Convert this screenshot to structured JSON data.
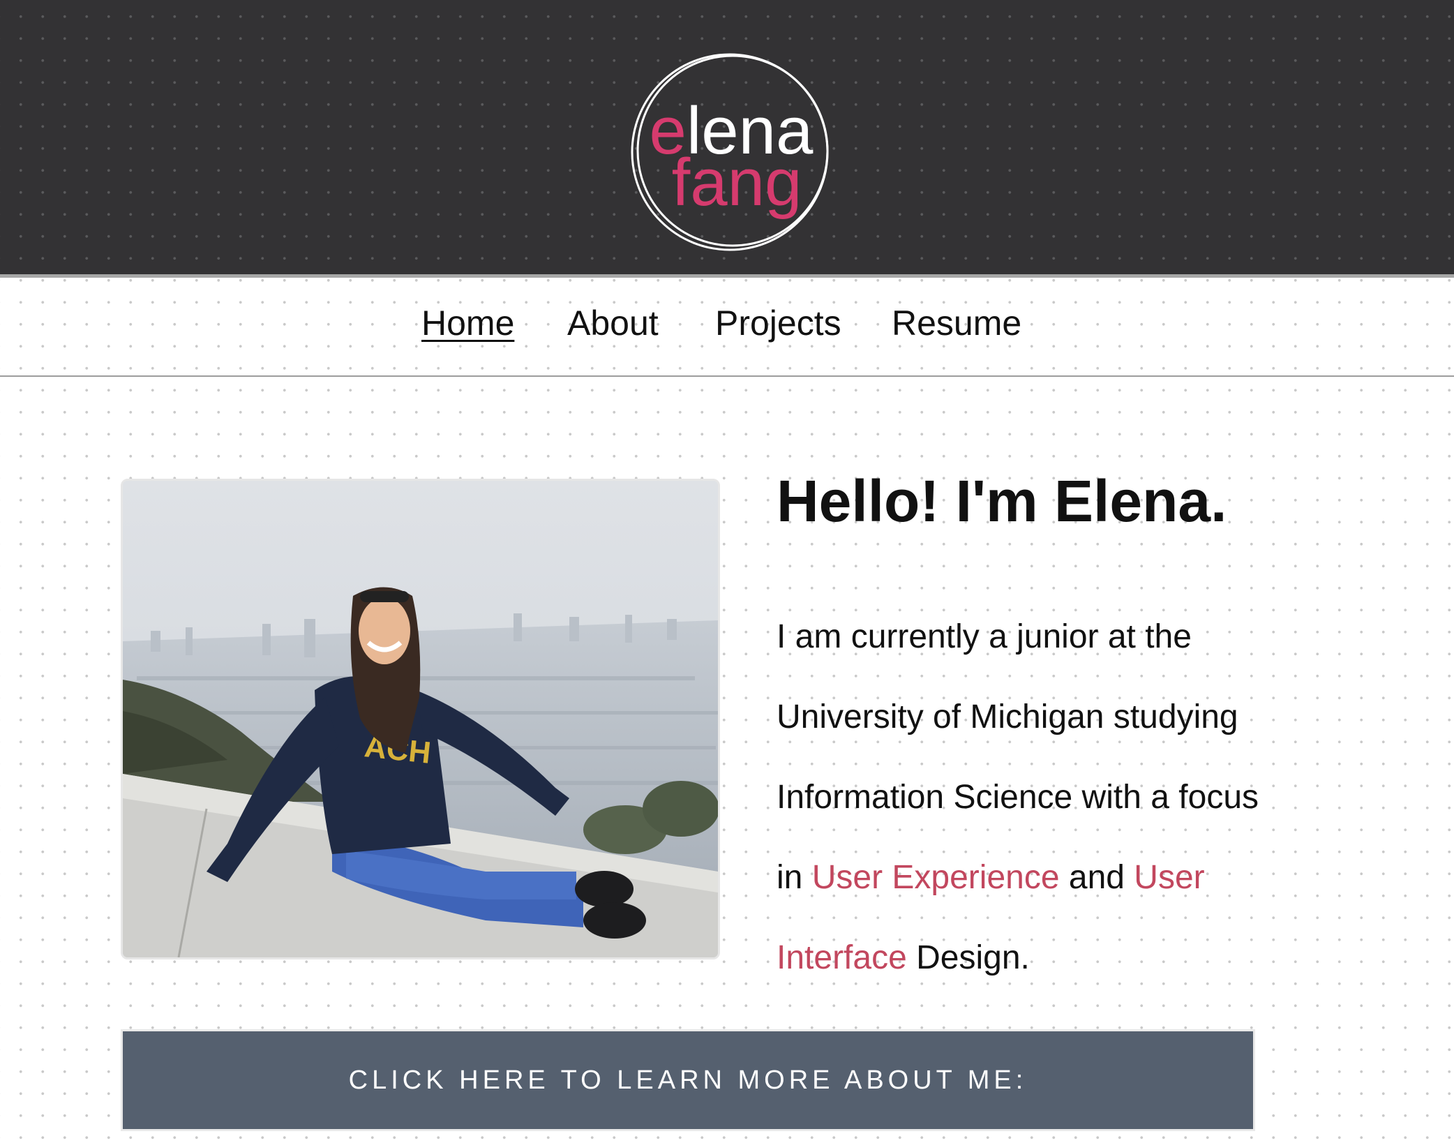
{
  "brand": {
    "logo_first": "elena",
    "logo_last": "fang",
    "accent_color": "#d63b6e",
    "header_color": "#333234"
  },
  "nav": {
    "items": [
      {
        "label": "Home",
        "active": true
      },
      {
        "label": "About",
        "active": false
      },
      {
        "label": "Projects",
        "active": false
      },
      {
        "label": "Resume",
        "active": false
      }
    ]
  },
  "main": {
    "greeting": "Hello! I'm Elena.",
    "intro": {
      "line1": "I am currently a junior at the",
      "line2": "University of Michigan studying",
      "line3": "Information Science with a focus",
      "line4_prefix": "in ",
      "line4_link1": "User Experience",
      "line4_mid": " and ",
      "line4_link2a": "User",
      "line5_link2b": "Interface",
      "line5_suffix": " Design."
    },
    "link_color": "#c2475e",
    "photo": {
      "subject": "photo-of-elena-sitting-on-wall-above-city"
    },
    "cta_label": "CLICK HERE TO LEARN MORE ABOUT ME:",
    "cta_color": "#55606f"
  }
}
